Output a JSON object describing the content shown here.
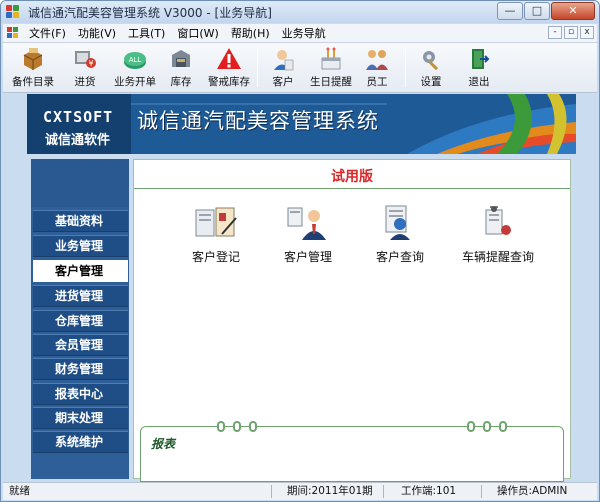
{
  "window": {
    "title": "诚信通汽配美容管理系统 V3000 - [业务导航]",
    "controls": {
      "minimize": "—",
      "maximize": "□",
      "close": "✕"
    }
  },
  "menubar": {
    "items": [
      {
        "label": "文件(F)"
      },
      {
        "label": "功能(V)"
      },
      {
        "label": "工具(T)"
      },
      {
        "label": "窗口(W)"
      },
      {
        "label": "帮助(H)"
      },
      {
        "label": "业务导航"
      }
    ],
    "mdi_controls": {
      "minimize": "-",
      "restore": "▫",
      "close": "x"
    }
  },
  "toolbar": {
    "items": [
      {
        "label": "备件目录",
        "icon": "parts-catalog-icon"
      },
      {
        "label": "进货",
        "icon": "purchase-icon"
      },
      {
        "label": "业务开单",
        "icon": "billing-icon"
      },
      {
        "label": "库存",
        "icon": "inventory-icon"
      },
      {
        "label": "警戒库存",
        "icon": "warning-icon"
      },
      {
        "label": "客户",
        "icon": "customer-icon"
      },
      {
        "label": "生日提醒",
        "icon": "birthday-icon"
      },
      {
        "label": "员工",
        "icon": "staff-icon"
      },
      {
        "label": "设置",
        "icon": "settings-icon"
      },
      {
        "label": "退出",
        "icon": "exit-icon"
      }
    ]
  },
  "banner": {
    "brand_en": "CXTSOFT",
    "brand_cn": "诚信通软件",
    "system_title": "诚信通汽配美容管理系统"
  },
  "nav": {
    "items": [
      {
        "label": "基础资料",
        "active": false
      },
      {
        "label": "业务管理",
        "active": false
      },
      {
        "label": "客户管理",
        "active": true
      },
      {
        "label": "进货管理",
        "active": false
      },
      {
        "label": "仓库管理",
        "active": false
      },
      {
        "label": "会员管理",
        "active": false
      },
      {
        "label": "财务管理",
        "active": false
      },
      {
        "label": "报表中心",
        "active": false
      },
      {
        "label": "期末处理",
        "active": false
      },
      {
        "label": "系统维护",
        "active": false
      }
    ]
  },
  "content": {
    "trial_label": "试用版",
    "functions": [
      {
        "label": "客户登记",
        "icon": "customer-register-icon"
      },
      {
        "label": "客户管理",
        "icon": "customer-manage-icon"
      },
      {
        "label": "客户查询",
        "icon": "customer-query-icon"
      },
      {
        "label": "车辆提醒查询",
        "icon": "vehicle-reminder-icon"
      }
    ],
    "report_label": "报表"
  },
  "statusbar": {
    "status": "就绪",
    "period": "期间:2011年01期",
    "workstation": "工作端:101",
    "operator": "操作员:ADMIN"
  },
  "colors": {
    "banner_bg": "#1e5a96",
    "nav_bg": "#1f4e86",
    "trial_red": "#d8282a",
    "accent_green": "#6ea26e"
  }
}
